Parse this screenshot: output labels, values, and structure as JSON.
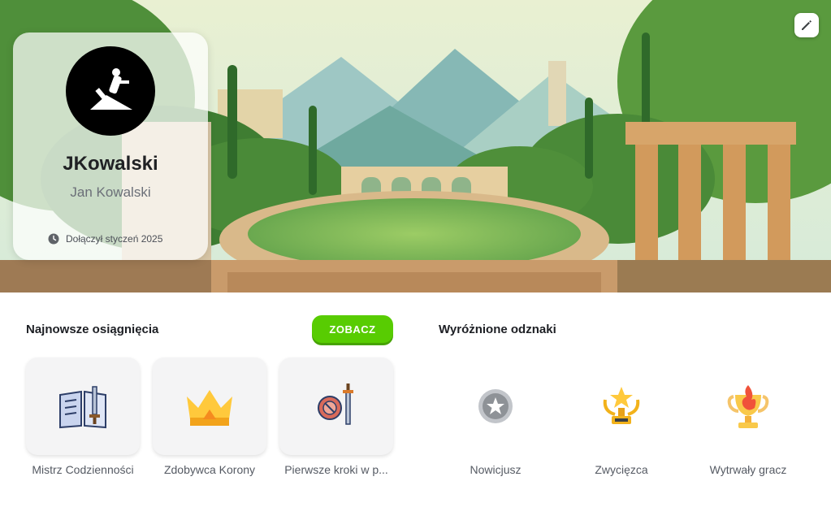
{
  "profile": {
    "username": "JKowalski",
    "full_name": "Jan Kowalski",
    "joined": "Dołączył styczeń 2025"
  },
  "achievements": {
    "title": "Najnowsze osiągnięcia",
    "see_label": "ZOBACZ",
    "items": [
      {
        "label": "Mistrz Codzienności",
        "icon": "book-sword-icon"
      },
      {
        "label": "Zdobywca Korony",
        "icon": "crown-icon"
      },
      {
        "label": "Pierwsze kroki w p...",
        "icon": "shield-sword-icon"
      }
    ]
  },
  "badges": {
    "title": "Wyróżnione odznaki",
    "items": [
      {
        "label": "Nowicjusz",
        "icon": "silver-star-medal-icon"
      },
      {
        "label": "Zwycięzca",
        "icon": "gold-trophy-icon"
      },
      {
        "label": "Wytrwały gracz",
        "icon": "flame-trophy-icon"
      }
    ]
  },
  "colors": {
    "accent": "#58cc02"
  }
}
